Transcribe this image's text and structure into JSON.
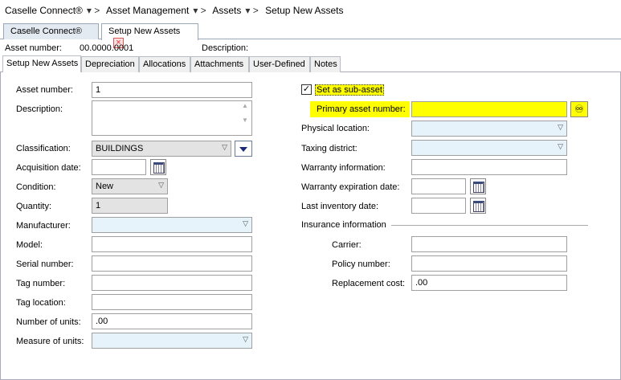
{
  "breadcrumb": [
    "Caselle Connect®",
    "Asset Management",
    "Assets",
    "Setup New Assets"
  ],
  "doc_tabs": [
    "Caselle Connect®",
    "Setup New Assets"
  ],
  "info": {
    "asset_number_label": "Asset number:",
    "asset_number_value": "00.0000.0001",
    "description_label": "Description:"
  },
  "tabs": [
    "Setup New Assets",
    "Depreciation",
    "Allocations",
    "Attachments",
    "User-Defined",
    "Notes"
  ],
  "left": {
    "asset_number": {
      "label": "Asset number:",
      "value": "1"
    },
    "description": {
      "label": "Description:",
      "value": ""
    },
    "classification": {
      "label": "Classification:",
      "value": "BUILDINGS"
    },
    "acquisition_date": {
      "label": "Acquisition date:",
      "value": ""
    },
    "condition": {
      "label": "Condition:",
      "value": "New"
    },
    "quantity": {
      "label": "Quantity:",
      "value": "1"
    },
    "manufacturer": {
      "label": "Manufacturer:",
      "value": ""
    },
    "model": {
      "label": "Model:",
      "value": ""
    },
    "serial_number": {
      "label": "Serial number:",
      "value": ""
    },
    "tag_number": {
      "label": "Tag number:",
      "value": ""
    },
    "tag_location": {
      "label": "Tag location:",
      "value": ""
    },
    "number_of_units": {
      "label": "Number of units:",
      "value": ".00"
    },
    "measure_of_units": {
      "label": "Measure of units:",
      "value": ""
    }
  },
  "right": {
    "sub_asset": {
      "label": "Set as sub-asset",
      "checked": "✓"
    },
    "primary_asset": {
      "label": "Primary asset number:",
      "value": ""
    },
    "physical_location": {
      "label": "Physical location:",
      "value": ""
    },
    "taxing_district": {
      "label": "Taxing district:",
      "value": ""
    },
    "warranty_info": {
      "label": "Warranty information:",
      "value": ""
    },
    "warranty_exp": {
      "label": "Warranty expiration date:",
      "value": ""
    },
    "last_inventory": {
      "label": "Last inventory date:",
      "value": ""
    },
    "insurance_header": "Insurance information",
    "carrier": {
      "label": "Carrier:",
      "value": ""
    },
    "policy_number": {
      "label": "Policy number:",
      "value": ""
    },
    "replacement_cost": {
      "label": "Replacement cost:",
      "value": ".00"
    }
  },
  "icons": {
    "dropdown": "chevron-down-icon",
    "calendar": "calendar-icon",
    "search": "binoculars-icon",
    "close": "close-icon"
  }
}
